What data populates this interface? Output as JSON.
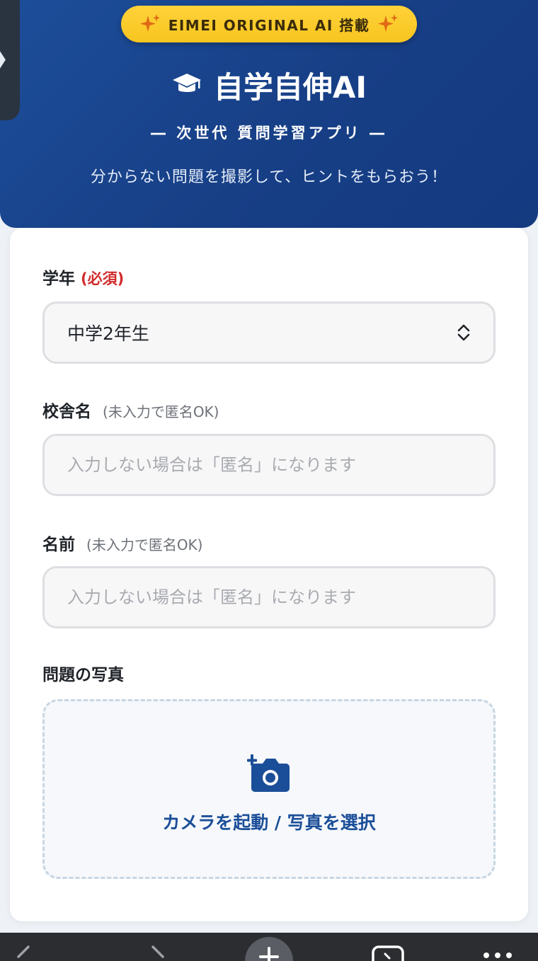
{
  "header": {
    "badge_text": "EIMEI ORIGINAL AI 搭載",
    "app_title": "自学自伸AI",
    "subtitle": "― 次世代 質問学習アプリ ―",
    "tagline": "分からない問題を撮影して、ヒントをもらおう！"
  },
  "form": {
    "grade": {
      "label": "学年",
      "required_text": "(必須)",
      "selected_value": "中学2年生"
    },
    "school": {
      "label": "校舎名",
      "hint": "(未入力で匿名OK)",
      "placeholder": "入力しない場合は「匿名」になります"
    },
    "name": {
      "label": "名前",
      "hint": "(未入力で匿名OK)",
      "placeholder": "入力しない場合は「匿名」になります"
    },
    "photo": {
      "label": "問題の写真",
      "upload_text": "カメラを起動 / 写真を選択"
    }
  },
  "icons": {
    "sparkle": "sparkle-icon",
    "graduation_cap": "graduation-cap-icon",
    "select_arrows": "chevron-up-down-icon",
    "camera_add": "camera-plus-icon",
    "side_toggle": "chevron-right-icon"
  },
  "colors": {
    "header_blue": "#173f86",
    "badge_yellow": "#f7c51f",
    "required_red": "#d12b2b",
    "accent_blue": "#1b4e98",
    "browser_bar": "#2b2d31"
  }
}
